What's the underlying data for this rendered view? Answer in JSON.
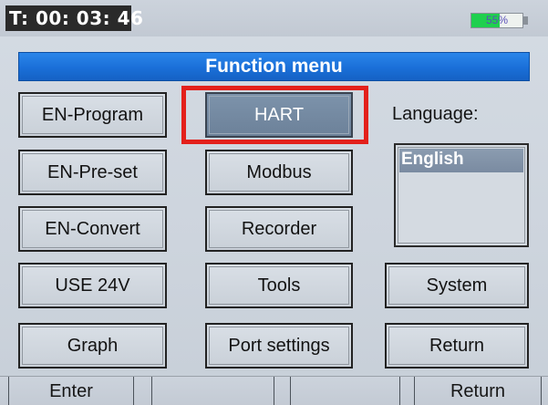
{
  "status": {
    "timer": "T: 00: 03: 46",
    "battery_text": "55%",
    "battery_level_percent": 55,
    "battery_color": "#1fd04e"
  },
  "header": {
    "title": "Function menu",
    "color": "#1a6fd8"
  },
  "menu": {
    "en_program": "EN-Program",
    "hart": "HART",
    "en_preset": "EN-Pre-set",
    "modbus": "Modbus",
    "en_convert": "EN-Convert",
    "recorder": "Recorder",
    "use_24v": "USE 24V",
    "tools": "Tools",
    "system": "System",
    "graph": "Graph",
    "port_settings": "Port settings",
    "return": "Return",
    "selected": "HART",
    "highlight_color": "#e3201b"
  },
  "language": {
    "label": "Language:",
    "options": [
      "English"
    ],
    "selected": "English"
  },
  "softkeys": {
    "left": "Enter",
    "right": "Return"
  }
}
